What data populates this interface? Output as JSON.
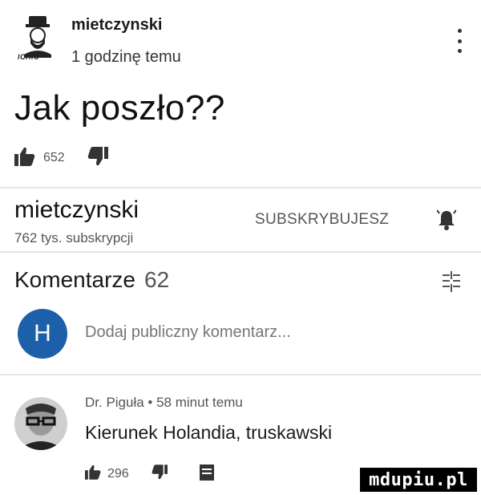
{
  "post": {
    "author": "mietczynski",
    "time": "1 godzinę temu",
    "avatar_text": "ICHIC",
    "title": "Jak poszło??",
    "likes": "652"
  },
  "channel": {
    "name": "mietczynski",
    "subscribers": "762 tys. subskrypcji",
    "subscribe_label": "SUBSKRYBUJESZ"
  },
  "comments": {
    "label": "Komentarze",
    "count": "62",
    "input_placeholder": "Dodaj publiczny komentarz...",
    "my_avatar_letter": "H",
    "items": [
      {
        "meta": "Dr. Piguła • 58 minut temu",
        "text": "Kierunek Holandia, truskawski",
        "likes": "296"
      }
    ]
  },
  "watermark": "mdupiu.pl",
  "colors": {
    "accent_blue": "#1d5fa8",
    "icon_dark": "#333333",
    "divider": "#e6e6e6"
  }
}
